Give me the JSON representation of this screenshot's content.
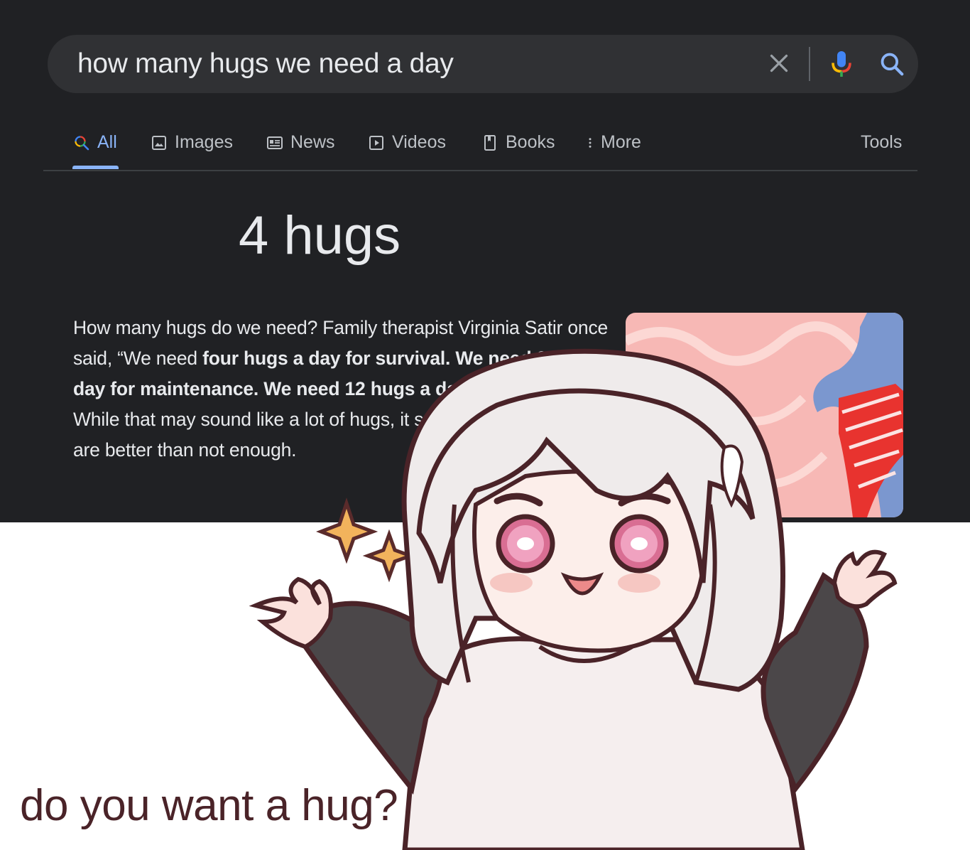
{
  "search": {
    "query": "how many hugs we need a day",
    "clear_icon": "close-icon",
    "mic_icon": "microphone-icon",
    "search_icon": "search-icon"
  },
  "tabs": [
    {
      "label": "All",
      "icon": "search-icon",
      "active": true
    },
    {
      "label": "Images",
      "icon": "image-icon"
    },
    {
      "label": "News",
      "icon": "news-icon"
    },
    {
      "label": "Videos",
      "icon": "play-icon"
    },
    {
      "label": "Books",
      "icon": "book-icon"
    },
    {
      "label": "More",
      "icon": "more-vertical-icon"
    }
  ],
  "tools_label": "Tools",
  "answer": "4 hugs",
  "snippet": {
    "p1": "How many hugs do we need? Family therapist Virginia Satir once said, “We need ",
    "b1": "four hugs a day for survival. We need 8 hugs a day for maintenance. We need 12 hugs a day for growth",
    "p2": ".” While that may sound like a lot of hugs, it seems that many hugs are better than not enough."
  },
  "caption": "do you want a hug?",
  "colors": {
    "dark_bg": "#202124",
    "search_bg": "#303134",
    "active_tab": "#8ab4f8",
    "text": "#e8eaed",
    "caption": "#4a2328"
  }
}
